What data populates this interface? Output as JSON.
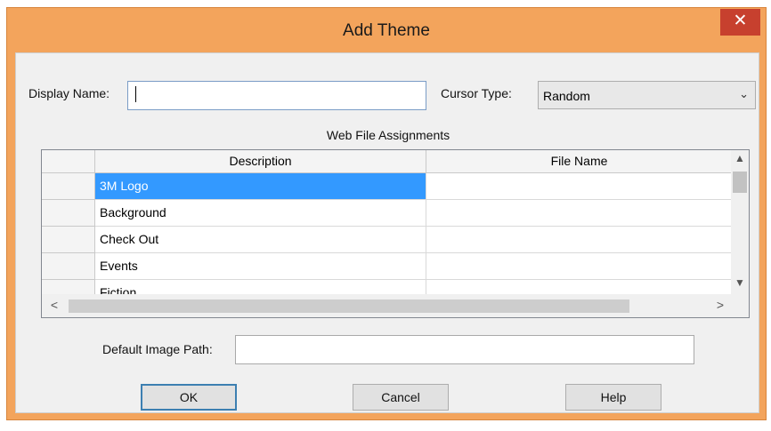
{
  "dialog": {
    "title": "Add Theme",
    "close_glyph": "✕"
  },
  "form": {
    "display_name_label": "Display Name:",
    "display_name_value": "",
    "cursor_type_label": "Cursor Type:",
    "cursor_type_value": "Random"
  },
  "web_files": {
    "caption": "Web File Assignments",
    "columns": [
      "Description",
      "File Name"
    ],
    "rows": [
      {
        "description": "3M Logo",
        "file_name": "",
        "selected": true
      },
      {
        "description": "Background",
        "file_name": ""
      },
      {
        "description": "Check Out",
        "file_name": ""
      },
      {
        "description": "Events",
        "file_name": ""
      },
      {
        "description": "Fiction",
        "file_name": ""
      }
    ]
  },
  "scrollbars": {
    "up": "▲",
    "down": "▼",
    "left": "<",
    "right": ">"
  },
  "default_image": {
    "label": "Default Image Path:",
    "value": ""
  },
  "buttons": {
    "ok": "OK",
    "cancel": "Cancel",
    "help": "Help"
  },
  "colors": {
    "title_bar": "#f3a45c",
    "close_button": "#c7402e",
    "selection": "#3399ff"
  },
  "icons": {
    "close": "close-icon",
    "dropdown": "chevron-down-icon"
  }
}
